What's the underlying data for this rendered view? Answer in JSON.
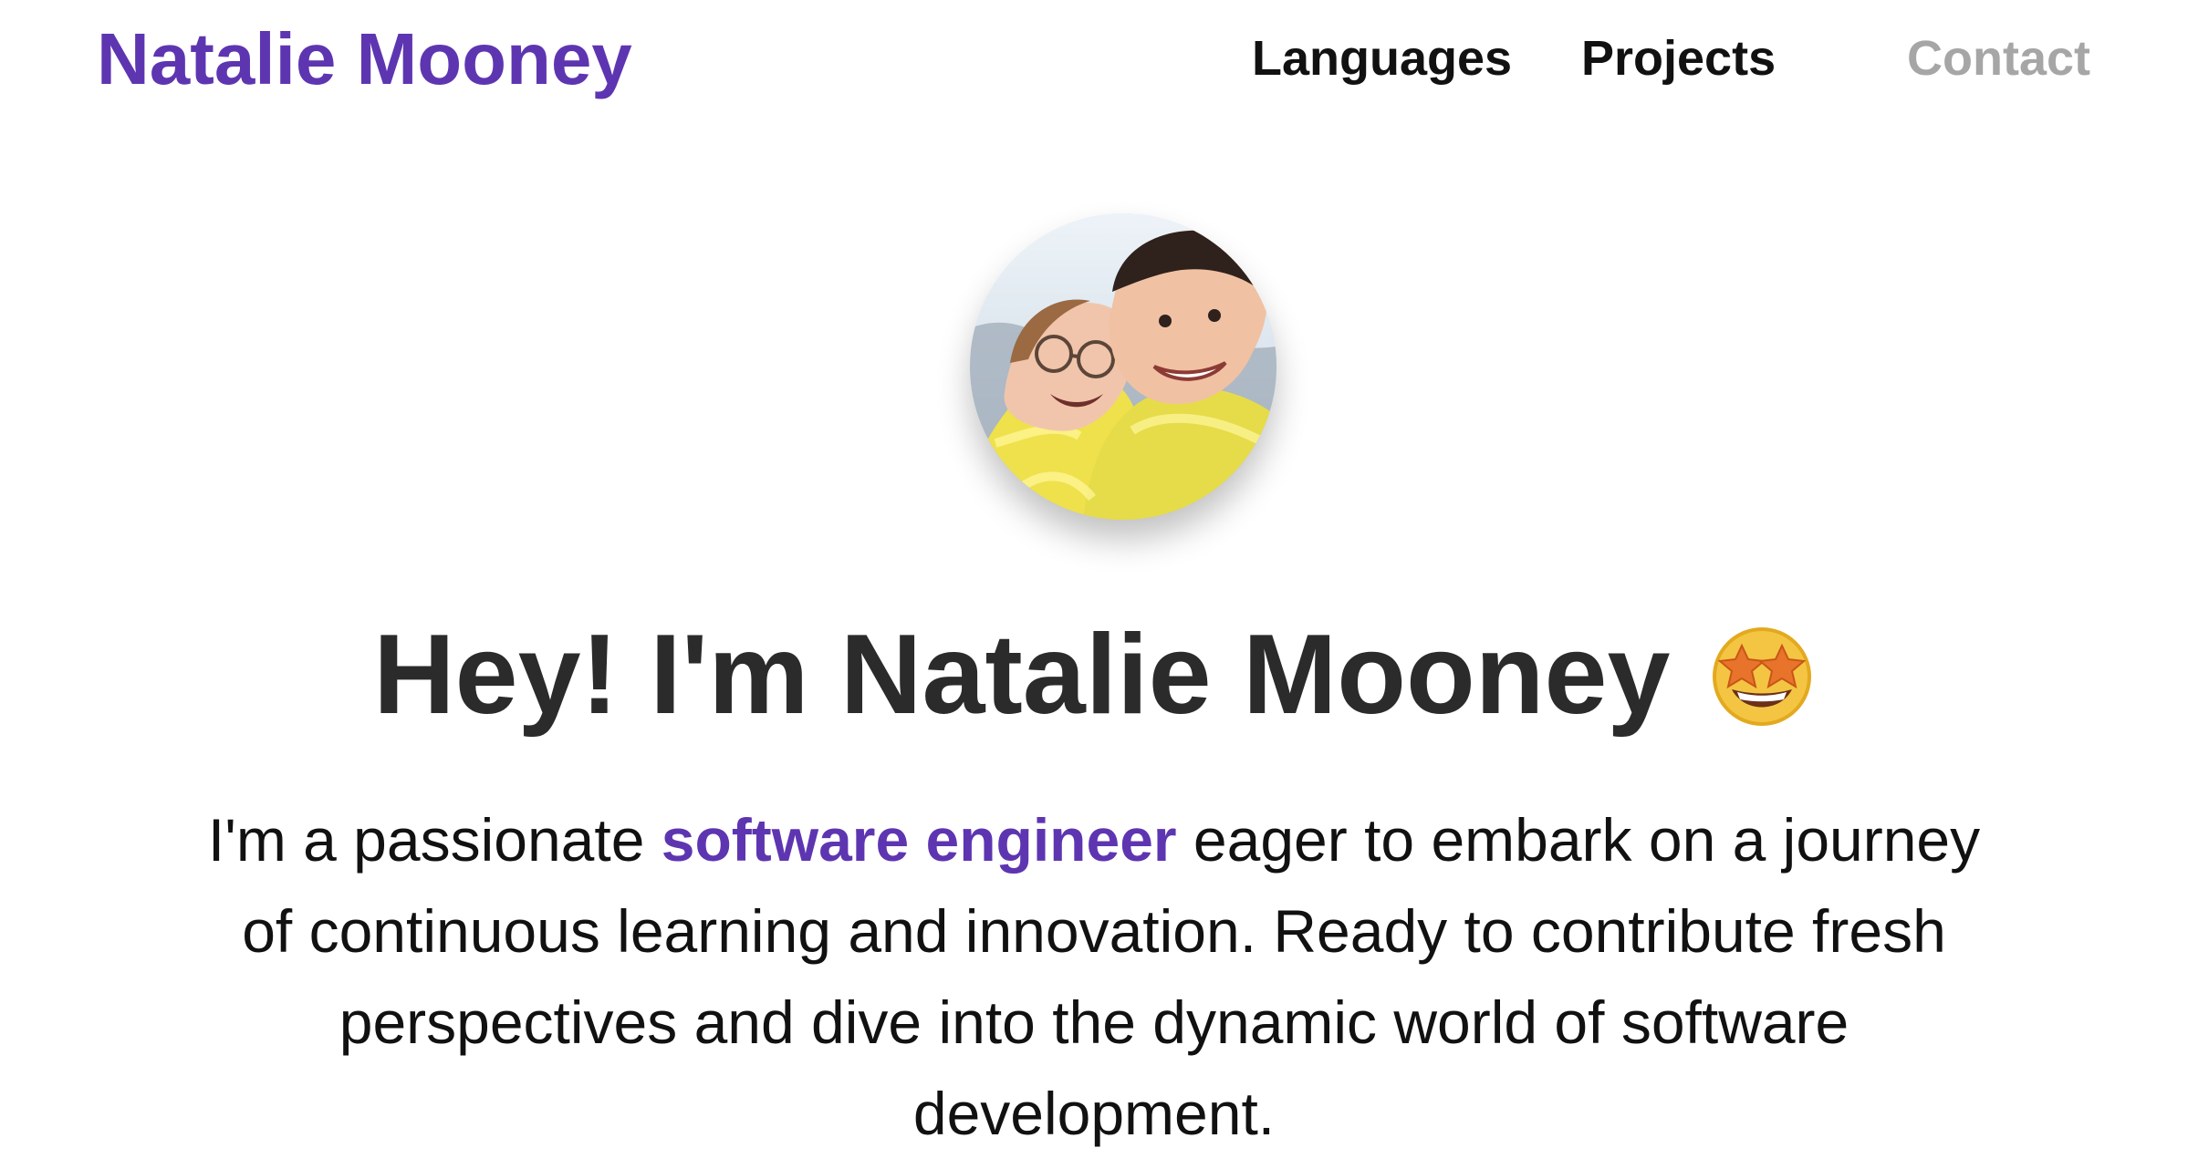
{
  "header": {
    "brand": "Natalie Mooney",
    "nav": {
      "languages": "Languages",
      "projects": "Projects",
      "contact": "Contact"
    }
  },
  "hero": {
    "avatar_icon": "profile-photo",
    "title": "Hey! I'm Natalie Mooney",
    "emoji_icon": "star-struck-emoji",
    "intro": {
      "line1_before": "I'm a passionate ",
      "highlight": "software engineer",
      "line1_after": " eager to embark on a journey",
      "line2": "of continuous learning and innovation. Ready to contribute fresh",
      "line3": "perspectives and dive into the dynamic world of software",
      "line4": "development."
    }
  },
  "colors": {
    "accent": "#5e35b1",
    "text": "#111111",
    "heading": "#2b2b2b",
    "muted_nav": "#a6a6a6",
    "background": "#ffffff"
  }
}
